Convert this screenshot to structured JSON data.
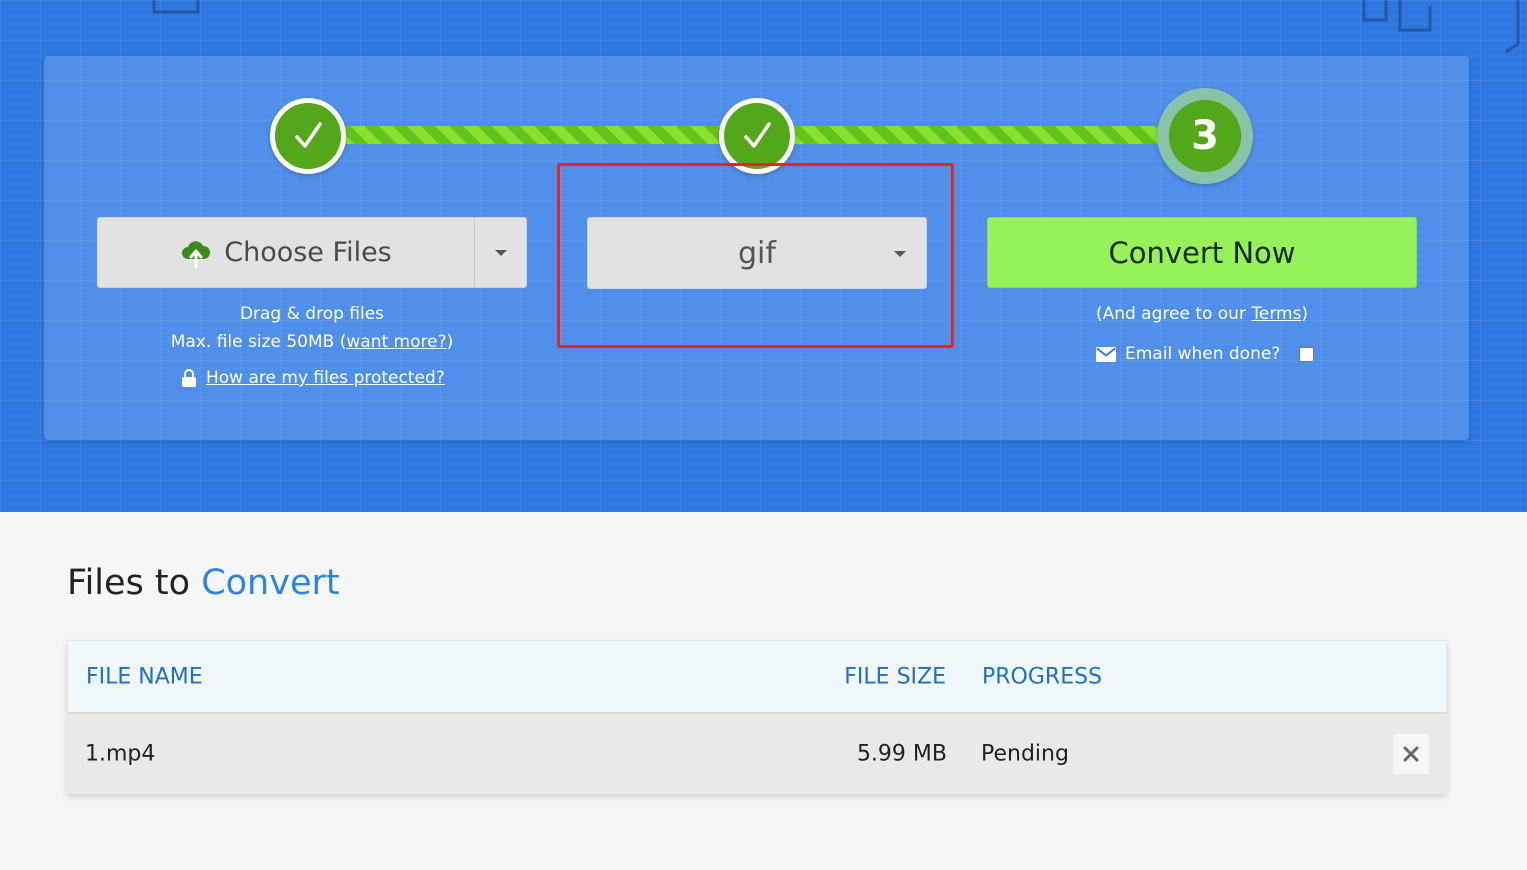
{
  "stepper": {
    "step3_label": "3"
  },
  "upload": {
    "choose_label": "Choose Files",
    "drag_text": "Drag & drop files",
    "max_size_prefix": "Max. file size 50MB (",
    "want_more_link": "want more?",
    "max_size_suffix": ")",
    "protect_link": "How are my files protected?"
  },
  "format": {
    "selected": "gif"
  },
  "convert": {
    "button_label": "Convert Now",
    "agree_prefix": "(And agree to our ",
    "terms_link": "Terms",
    "agree_suffix": ")",
    "email_label": "Email when done?",
    "email_checked": false
  },
  "files_section": {
    "title_plain": "Files to ",
    "title_accent": "Convert",
    "columns": [
      "FILE NAME",
      "FILE SIZE",
      "PROGRESS"
    ],
    "rows": [
      {
        "name": "1.mp4",
        "size": "5.99 MB",
        "progress": "Pending"
      }
    ]
  },
  "colors": {
    "hero_blue": "#2f76df",
    "step_green": "#52a71a",
    "convert_green": "#97f15a",
    "highlight_red": "#ea2426",
    "accent_blue": "#2d85e0"
  },
  "icons": {
    "step1": "checkmark-icon",
    "step2": "checkmark-icon",
    "choose": "cloud-upload-icon",
    "dropdown": "caret-down-icon",
    "protect": "lock-icon",
    "email": "envelope-icon",
    "remove": "close-icon"
  }
}
